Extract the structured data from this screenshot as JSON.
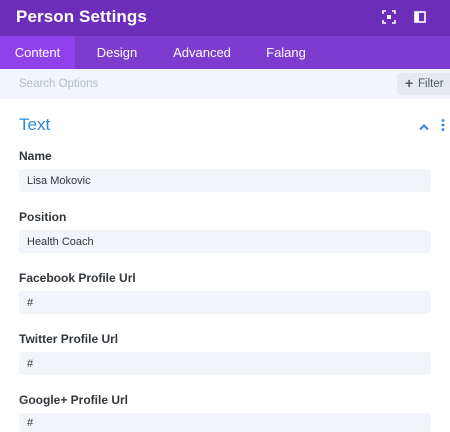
{
  "header": {
    "title": "Person Settings",
    "icons": [
      "expand-icon",
      "split-view-icon"
    ]
  },
  "tabs": [
    {
      "label": "Content",
      "active": true
    },
    {
      "label": "Design",
      "active": false
    },
    {
      "label": "Advanced",
      "active": false
    },
    {
      "label": "Falang",
      "active": false
    }
  ],
  "search": {
    "placeholder": "Search Options",
    "value": "",
    "filter_label": "Filter"
  },
  "section": {
    "title": "Text"
  },
  "fields": [
    {
      "label": "Name",
      "value": "Lisa Mokovic"
    },
    {
      "label": "Position",
      "value": "Health Coach"
    },
    {
      "label": "Facebook Profile Url",
      "value": "#"
    },
    {
      "label": "Twitter Profile Url",
      "value": "#"
    },
    {
      "label": "Google+ Profile Url",
      "value": "#"
    }
  ],
  "colors": {
    "header_bg": "#6c2eb9",
    "tabs_bg": "#7e3bd0",
    "active_tab_bg": "#8f42ec",
    "accent_blue": "#2b87da",
    "input_bg": "#f1f5f9"
  }
}
